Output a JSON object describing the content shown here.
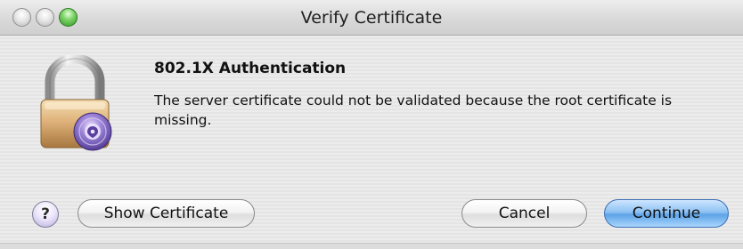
{
  "window": {
    "title": "Verify Certificate"
  },
  "dialog": {
    "icon": "lock-certificate-icon",
    "heading": "802.1X Authentication",
    "message": "The server certificate could not be validated because the root certificate is missing."
  },
  "buttons": {
    "help_label": "?",
    "show_certificate_label": "Show Certificate",
    "cancel_label": "Cancel",
    "continue_label": "Continue"
  },
  "colors": {
    "default_button": "#5ea3e6",
    "zoom_button": "#4cb83a"
  }
}
